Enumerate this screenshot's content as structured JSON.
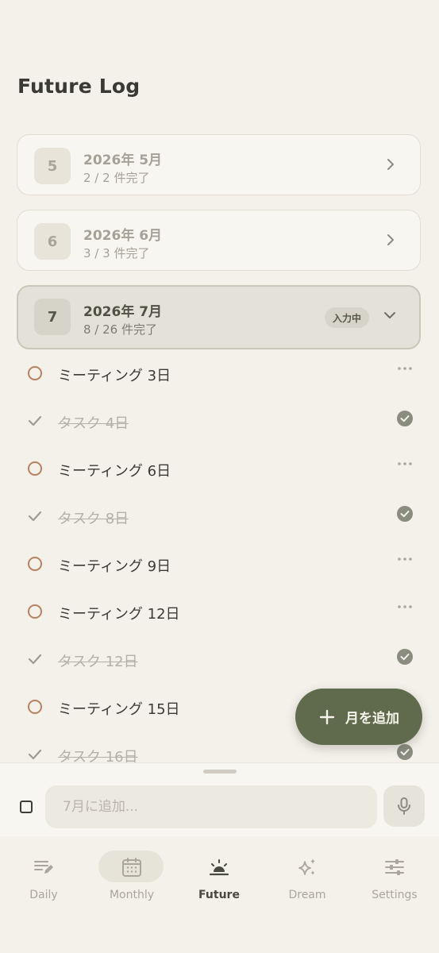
{
  "header": {
    "title": "Future Log"
  },
  "months": [
    {
      "number": "5",
      "title": "2026年 5月",
      "progress": "2 / 2 件完了",
      "expanded": false
    },
    {
      "number": "6",
      "title": "2026年 6月",
      "progress": "3 / 3 件完了",
      "expanded": false
    },
    {
      "number": "7",
      "title": "2026年 7月",
      "progress": "8 / 26 件完了",
      "expanded": true,
      "status": "入力中"
    }
  ],
  "tasks": [
    {
      "label": "ミーティング 3日",
      "done": false
    },
    {
      "label": "タスク 4日",
      "done": true
    },
    {
      "label": "ミーティング 6日",
      "done": false
    },
    {
      "label": "タスク 8日",
      "done": true
    },
    {
      "label": "ミーティング 9日",
      "done": false
    },
    {
      "label": "ミーティング 12日",
      "done": false
    },
    {
      "label": "タスク 12日",
      "done": true
    },
    {
      "label": "ミーティング 15日",
      "done": false
    },
    {
      "label": "タスク 16日",
      "done": true
    }
  ],
  "fab": {
    "label": "月を追加",
    "icon": "plus-icon"
  },
  "quick_add": {
    "placeholder": "7月に追加...",
    "value": "",
    "mic_icon": "microphone-icon"
  },
  "nav": {
    "items": [
      {
        "label": "Daily",
        "icon": "notes-edit-icon",
        "active": false
      },
      {
        "label": "Monthly",
        "icon": "calendar-icon",
        "active": false
      },
      {
        "label": "Future",
        "icon": "sunrise-icon",
        "active": true
      },
      {
        "label": "Dream",
        "icon": "sparkles-icon",
        "active": false
      },
      {
        "label": "Settings",
        "icon": "sliders-icon",
        "active": false
      }
    ]
  },
  "colors": {
    "background": "#f4f1eb",
    "accent": "#5f6b4c",
    "open_task_ring": "#b8825f",
    "done_check": "#8a8c80",
    "text_primary": "#33332e",
    "text_muted": "#aaa69c"
  }
}
